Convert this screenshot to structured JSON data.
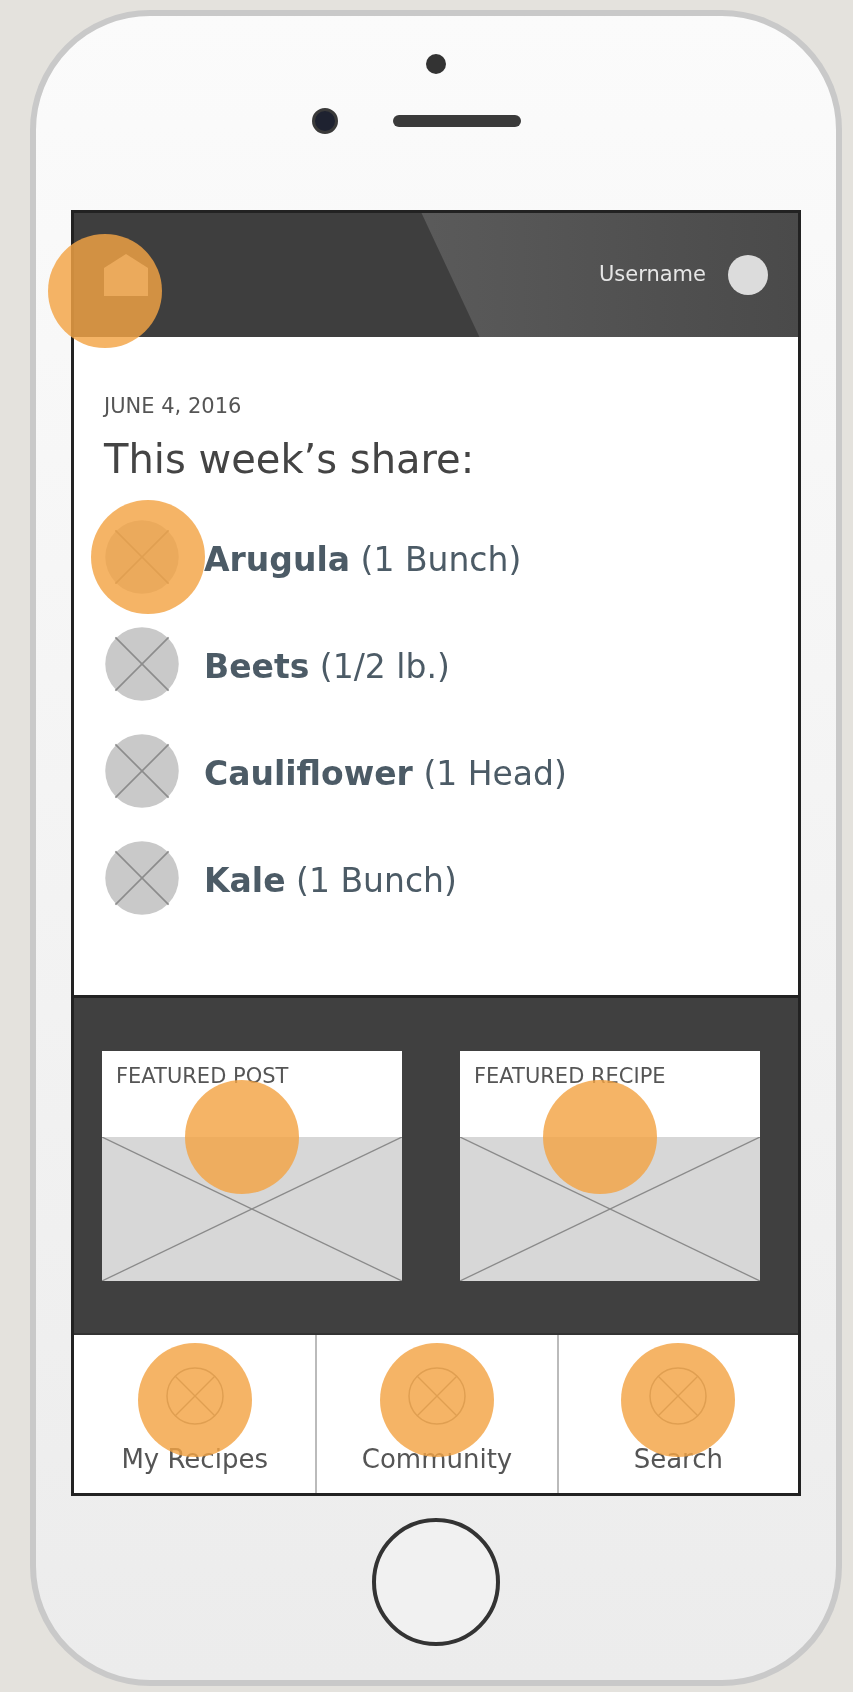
{
  "header": {
    "home_button": {
      "highlighted": true
    },
    "username": "Username"
  },
  "date": "JUNE 4, 2016",
  "heading": "This week’s share:",
  "items": [
    {
      "name": "Arugula",
      "quantity": "(1 Bunch)",
      "highlighted": true
    },
    {
      "name": "Beets",
      "quantity": "(1/2 lb.)",
      "highlighted": false
    },
    {
      "name": "Cauliflower",
      "quantity": "(1 Head)",
      "highlighted": false
    },
    {
      "name": "Kale",
      "quantity": "(1 Bunch)",
      "highlighted": false
    }
  ],
  "featured": [
    {
      "title": "FEATURED POST",
      "highlighted": true
    },
    {
      "title": "FEATURED RECIPE",
      "highlighted": true
    }
  ],
  "nav": [
    {
      "label": "My Recipes",
      "highlighted": true
    },
    {
      "label": "Community",
      "highlighted": true
    },
    {
      "label": "Search",
      "highlighted": true
    }
  ]
}
